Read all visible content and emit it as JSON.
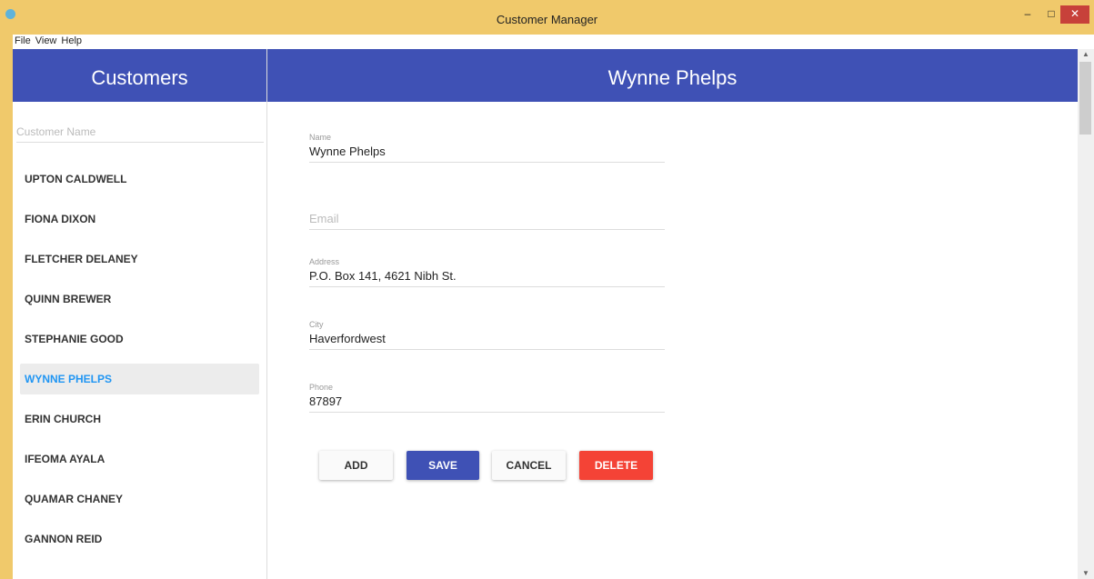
{
  "window": {
    "title": "Customer Manager",
    "icons": {
      "app": "app-icon",
      "minimize": "minimize-icon",
      "maximize": "maximize-icon",
      "close": "close-icon"
    },
    "minimize_glyph": "–",
    "maximize_glyph": "□",
    "close_glyph": "✕"
  },
  "menu": [
    "File",
    "View",
    "Help"
  ],
  "left": {
    "header": "Customers",
    "search_placeholder": "Customer Name",
    "customers": [
      "UPTON CALDWELL",
      "FIONA DIXON",
      "FLETCHER DELANEY",
      "QUINN BREWER",
      "STEPHANIE GOOD",
      "WYNNE PHELPS",
      "ERIN CHURCH",
      "IFEOMA AYALA",
      "QUAMAR CHANEY",
      "GANNON REID"
    ],
    "selected_index": 5
  },
  "detail": {
    "header": "Wynne Phelps",
    "fields": {
      "name_label": "Name",
      "name_value": "Wynne Phelps",
      "email_placeholder": "Email",
      "address_label": "Address",
      "address_value": "P.O. Box 141, 4621 Nibh St.",
      "city_label": "City",
      "city_value": "Haverfordwest",
      "phone_label": "Phone",
      "phone_value": "87897"
    },
    "buttons": {
      "add": "ADD",
      "save": "SAVE",
      "cancel": "CANCEL",
      "delete": "DELETE"
    }
  },
  "colors": {
    "titlebar": "#f0c96b",
    "primary": "#3f51b5",
    "delete": "#f44336",
    "selected_text": "#2196f3",
    "close": "#c7413a"
  },
  "scroll": {
    "up_glyph": "▲",
    "down_glyph": "▼"
  }
}
